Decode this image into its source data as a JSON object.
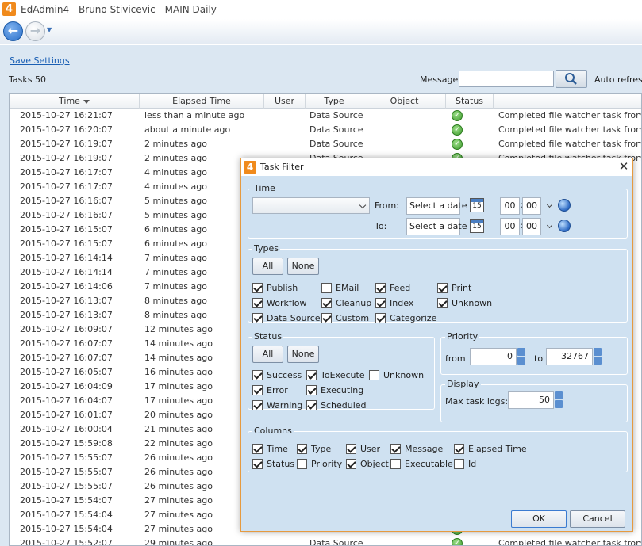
{
  "window": {
    "title": "EdAdmin4 - Bruno Stivicevic - MAIN Daily",
    "logo": "4"
  },
  "toolbar": {
    "save_settings": "Save Settings",
    "tasks_count": "Tasks 50",
    "message_label": "Message:",
    "message_value": "",
    "auto_refresh": "Auto refresh"
  },
  "grid": {
    "columns": [
      "Time",
      "Elapsed Time",
      "User",
      "Type",
      "Object",
      "Status"
    ],
    "rows": [
      {
        "time": "2015-10-27 16:21:07",
        "elapsed": "less than a minute ago",
        "type": "Data Source",
        "msg": "Completed file watcher task from que"
      },
      {
        "time": "2015-10-27 16:20:07",
        "elapsed": "about a minute ago",
        "type": "Data Source",
        "msg": "Completed file watcher task from que"
      },
      {
        "time": "2015-10-27 16:19:07",
        "elapsed": "2 minutes ago",
        "type": "Data Source",
        "msg": "Completed file watcher task from que"
      },
      {
        "time": "2015-10-27 16:19:07",
        "elapsed": "2 minutes ago",
        "type": "Data Source",
        "msg": "Completed file watcher task from que"
      },
      {
        "time": "2015-10-27 16:17:07",
        "elapsed": "4 minutes ago",
        "type": "",
        "msg": ""
      },
      {
        "time": "2015-10-27 16:17:07",
        "elapsed": "4 minutes ago",
        "type": "",
        "msg": ""
      },
      {
        "time": "2015-10-27 16:16:07",
        "elapsed": "5 minutes ago",
        "type": "",
        "msg": ""
      },
      {
        "time": "2015-10-27 16:16:07",
        "elapsed": "5 minutes ago",
        "type": "",
        "msg": ""
      },
      {
        "time": "2015-10-27 16:15:07",
        "elapsed": "6 minutes ago",
        "type": "",
        "msg": ""
      },
      {
        "time": "2015-10-27 16:15:07",
        "elapsed": "6 minutes ago",
        "type": "",
        "msg": ""
      },
      {
        "time": "2015-10-27 16:14:14",
        "elapsed": "7 minutes ago",
        "type": "",
        "msg": ""
      },
      {
        "time": "2015-10-27 16:14:14",
        "elapsed": "7 minutes ago",
        "type": "",
        "msg": ""
      },
      {
        "time": "2015-10-27 16:14:06",
        "elapsed": "7 minutes ago",
        "type": "",
        "msg": ""
      },
      {
        "time": "2015-10-27 16:13:07",
        "elapsed": "8 minutes ago",
        "type": "",
        "msg": ""
      },
      {
        "time": "2015-10-27 16:13:07",
        "elapsed": "8 minutes ago",
        "type": "",
        "msg": ""
      },
      {
        "time": "2015-10-27 16:09:07",
        "elapsed": "12 minutes ago",
        "type": "",
        "msg": ""
      },
      {
        "time": "2015-10-27 16:07:07",
        "elapsed": "14 minutes ago",
        "type": "",
        "msg": ""
      },
      {
        "time": "2015-10-27 16:07:07",
        "elapsed": "14 minutes ago",
        "type": "",
        "msg": ""
      },
      {
        "time": "2015-10-27 16:05:07",
        "elapsed": "16 minutes ago",
        "type": "",
        "msg": ""
      },
      {
        "time": "2015-10-27 16:04:09",
        "elapsed": "17 minutes ago",
        "type": "",
        "msg": ""
      },
      {
        "time": "2015-10-27 16:04:07",
        "elapsed": "17 minutes ago",
        "type": "",
        "msg": ""
      },
      {
        "time": "2015-10-27 16:01:07",
        "elapsed": "20 minutes ago",
        "type": "",
        "msg": ""
      },
      {
        "time": "2015-10-27 16:00:04",
        "elapsed": "21 minutes ago",
        "type": "",
        "msg": ""
      },
      {
        "time": "2015-10-27 15:59:08",
        "elapsed": "22 minutes ago",
        "type": "",
        "msg": ""
      },
      {
        "time": "2015-10-27 15:55:07",
        "elapsed": "26 minutes ago",
        "type": "",
        "msg": ""
      },
      {
        "time": "2015-10-27 15:55:07",
        "elapsed": "26 minutes ago",
        "type": "",
        "msg": ""
      },
      {
        "time": "2015-10-27 15:55:07",
        "elapsed": "26 minutes ago",
        "type": "",
        "msg": ""
      },
      {
        "time": "2015-10-27 15:54:07",
        "elapsed": "27 minutes ago",
        "type": "",
        "msg": ""
      },
      {
        "time": "2015-10-27 15:54:04",
        "elapsed": "27 minutes ago",
        "type": "",
        "msg": ""
      },
      {
        "time": "2015-10-27 15:54:04",
        "elapsed": "27 minutes ago",
        "type": "",
        "msg": ""
      },
      {
        "time": "2015-10-27 15:52:07",
        "elapsed": "29 minutes ago",
        "type": "Data Source",
        "msg": "Completed file watcher task from que"
      }
    ]
  },
  "dialog": {
    "title": "Task Filter",
    "logo": "4",
    "time": {
      "label": "Time",
      "from_label": "From:",
      "to_label": "To:",
      "date_placeholder": "Select a date",
      "calendar_day": "15",
      "hour": "00",
      "minute": "00"
    },
    "types": {
      "label": "Types",
      "all": "All",
      "none": "None",
      "items": [
        {
          "label": "Publish",
          "checked": true
        },
        {
          "label": "EMail",
          "checked": false
        },
        {
          "label": "Feed",
          "checked": true
        },
        {
          "label": "Print",
          "checked": true
        },
        {
          "label": "Workflow",
          "checked": true
        },
        {
          "label": "Cleanup",
          "checked": true
        },
        {
          "label": "Index",
          "checked": true
        },
        {
          "label": "Unknown",
          "checked": true
        },
        {
          "label": "Data Source",
          "checked": true
        },
        {
          "label": "Custom",
          "checked": true
        },
        {
          "label": "Categorize",
          "checked": true
        }
      ]
    },
    "status": {
      "label": "Status",
      "all": "All",
      "none": "None",
      "items": [
        {
          "label": "Success",
          "checked": true
        },
        {
          "label": "ToExecute",
          "checked": true
        },
        {
          "label": "Unknown",
          "checked": false
        },
        {
          "label": "Error",
          "checked": true
        },
        {
          "label": "Executing",
          "checked": true
        },
        {
          "label": "Warning",
          "checked": true
        },
        {
          "label": "Scheduled",
          "checked": true
        }
      ]
    },
    "priority": {
      "label": "Priority",
      "from_label": "from",
      "from_value": "0",
      "to_label": "to",
      "to_value": "32767"
    },
    "display": {
      "label": "Display",
      "max_label": "Max task logs:",
      "max_value": "50"
    },
    "columns": {
      "label": "Columns",
      "items": [
        {
          "label": "Time",
          "checked": true
        },
        {
          "label": "Type",
          "checked": true
        },
        {
          "label": "User",
          "checked": true
        },
        {
          "label": "Message",
          "checked": true
        },
        {
          "label": "Elapsed Time",
          "checked": true
        },
        {
          "label": "Status",
          "checked": true
        },
        {
          "label": "Priority",
          "checked": false
        },
        {
          "label": "Object",
          "checked": true
        },
        {
          "label": "Executable",
          "checked": false
        },
        {
          "label": "Id",
          "checked": false
        }
      ]
    },
    "ok": "OK",
    "cancel": "Cancel"
  },
  "colors": {
    "accent": "#f08a1c",
    "panel": "#cfe1f1",
    "background": "#dbe7f2",
    "link": "#1a5fb4",
    "success": "#3c9a2c"
  },
  "icons": {
    "back": "back-arrow-icon",
    "forward": "forward-arrow-icon",
    "search": "search-icon",
    "status": "success-check-icon",
    "calendar": "calendar-icon",
    "timezone": "globe-icon"
  }
}
